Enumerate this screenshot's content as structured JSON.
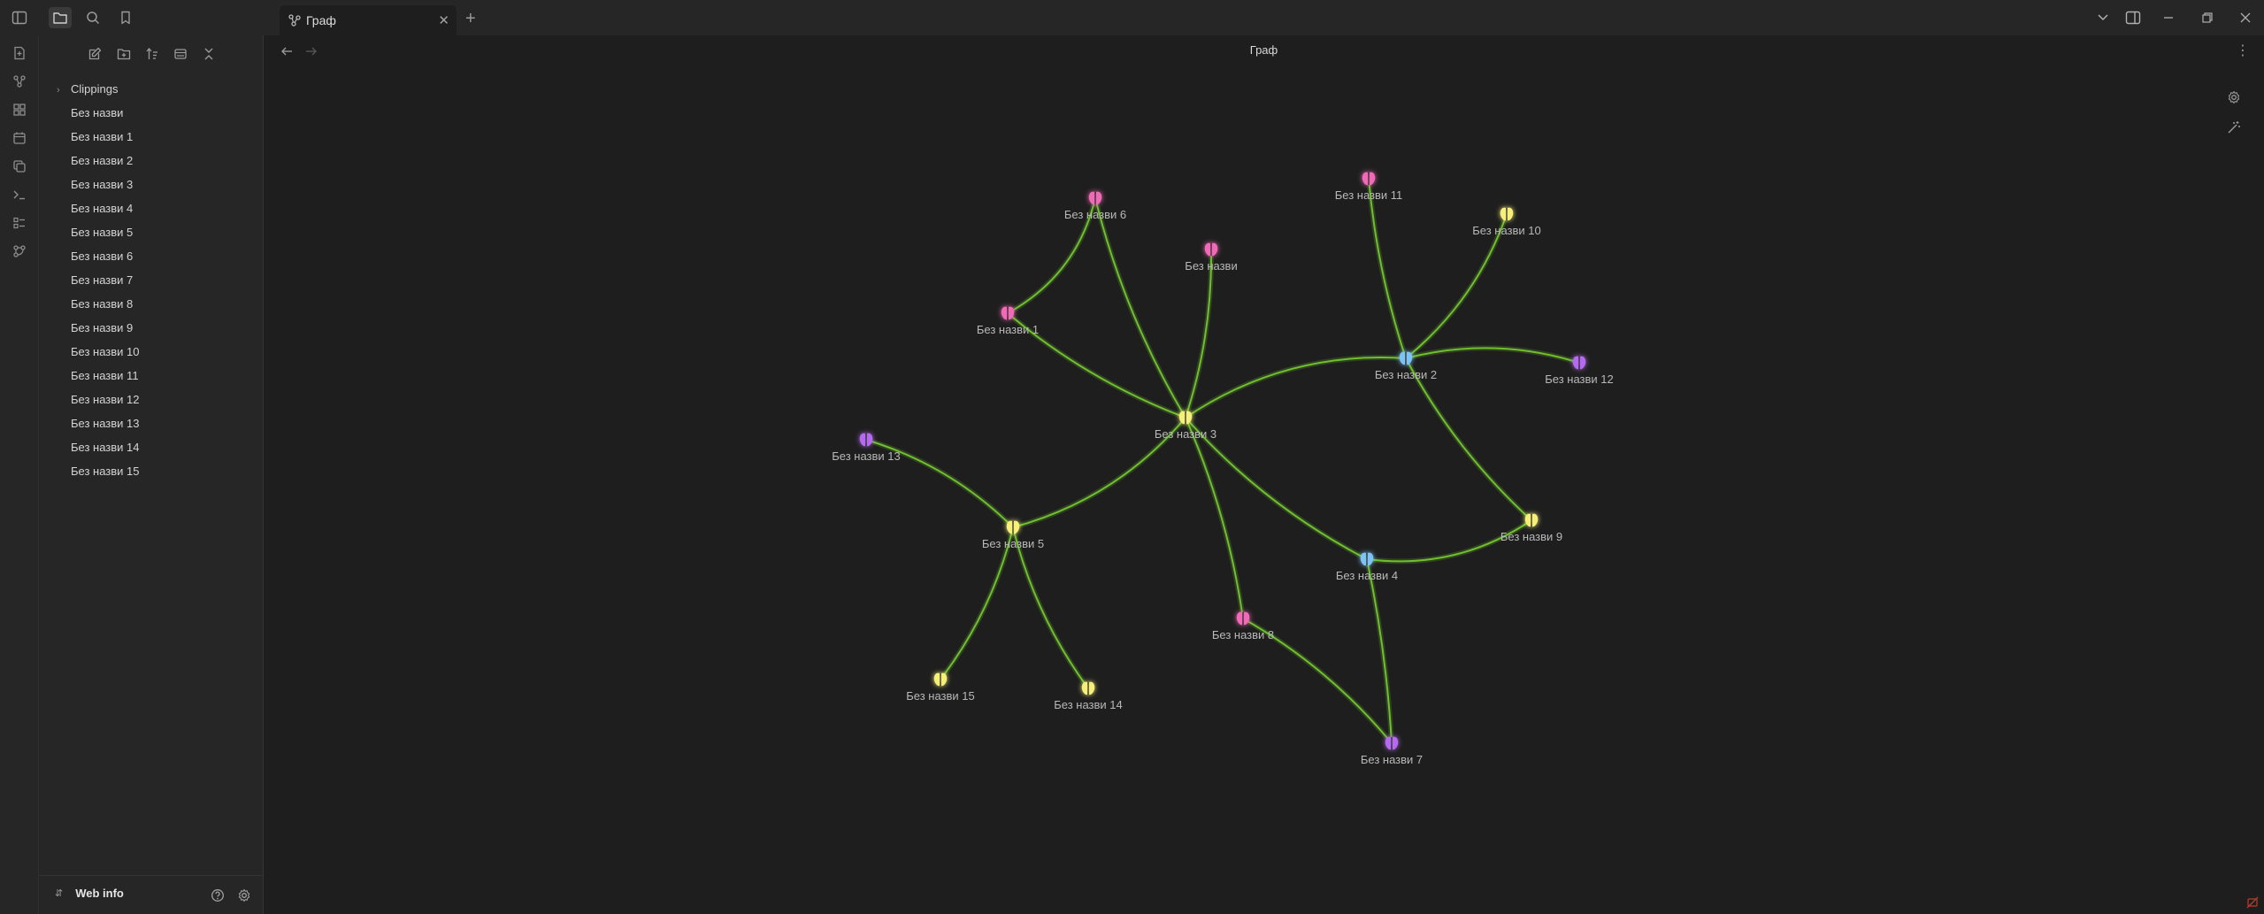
{
  "titlebar": {
    "tab_title": "Граф",
    "icons": [
      "sidebar-toggle-icon",
      "folder-icon",
      "search-icon",
      "bookmark-icon"
    ],
    "window_controls": [
      "chevron-down-icon",
      "layout-icon",
      "minimize-icon",
      "restore-icon",
      "close-icon"
    ]
  },
  "ribbon": {
    "icons": [
      "new-note-icon",
      "graph-icon",
      "canvas-icon",
      "calendar-icon",
      "copy-icon",
      "terminal-icon",
      "list-icon",
      "network-icon"
    ]
  },
  "sidebar": {
    "toolbar_icons": [
      "new-note-icon",
      "new-folder-icon",
      "sort-icon",
      "collapse-view-icon",
      "collapse-all-icon"
    ],
    "folder": "Clippings",
    "files": [
      "Без назви",
      "Без назви 1",
      "Без назви 2",
      "Без назви 3",
      "Без назви 4",
      "Без назви 5",
      "Без назви 6",
      "Без назви 7",
      "Без назви 8",
      "Без назви 9",
      "Без назви 10",
      "Без назви 11",
      "Без назви 12",
      "Без назви 13",
      "Без назви 14",
      "Без назви 15"
    ],
    "vault_name": "Web info"
  },
  "view": {
    "title": "Граф"
  },
  "graph": {
    "colors": {
      "edge": "#6fbf2f",
      "pink": "#f06ab7",
      "yellow": "#f6f07a",
      "blue": "#7fc3f5",
      "purple": "#b66bf0"
    },
    "nodes": [
      {
        "id": "n0",
        "label": "Без назви",
        "color": "pink"
      },
      {
        "id": "n1",
        "label": "Без назви 1",
        "color": "pink"
      },
      {
        "id": "n2",
        "label": "Без назви 2",
        "color": "blue"
      },
      {
        "id": "n3",
        "label": "Без назви 3",
        "color": "yellow"
      },
      {
        "id": "n4",
        "label": "Без назви 4",
        "color": "blue"
      },
      {
        "id": "n5",
        "label": "Без назви 5",
        "color": "yellow"
      },
      {
        "id": "n6",
        "label": "Без назви 6",
        "color": "pink"
      },
      {
        "id": "n7",
        "label": "Без назви 7",
        "color": "purple"
      },
      {
        "id": "n8",
        "label": "Без назви 8",
        "color": "pink"
      },
      {
        "id": "n9",
        "label": "Без назви 9",
        "color": "yellow"
      },
      {
        "id": "n10",
        "label": "Без назви 10",
        "color": "yellow"
      },
      {
        "id": "n11",
        "label": "Без назви 11",
        "color": "pink"
      },
      {
        "id": "n12",
        "label": "Без назви 12",
        "color": "purple"
      },
      {
        "id": "n13",
        "label": "Без назви 13",
        "color": "purple"
      },
      {
        "id": "n14",
        "label": "Без назви 14",
        "color": "yellow"
      },
      {
        "id": "n15",
        "label": "Без назви 15",
        "color": "yellow"
      }
    ],
    "edges": [
      [
        "n6",
        "n1"
      ],
      [
        "n6",
        "n3"
      ],
      [
        "n0",
        "n3"
      ],
      [
        "n1",
        "n3"
      ],
      [
        "n3",
        "n2"
      ],
      [
        "n3",
        "n5"
      ],
      [
        "n3",
        "n4"
      ],
      [
        "n3",
        "n8"
      ],
      [
        "n11",
        "n2"
      ],
      [
        "n10",
        "n2"
      ],
      [
        "n2",
        "n12"
      ],
      [
        "n2",
        "n9"
      ],
      [
        "n4",
        "n9"
      ],
      [
        "n4",
        "n7"
      ],
      [
        "n8",
        "n7"
      ],
      [
        "n13",
        "n5"
      ],
      [
        "n5",
        "n15"
      ],
      [
        "n5",
        "n14"
      ]
    ]
  }
}
